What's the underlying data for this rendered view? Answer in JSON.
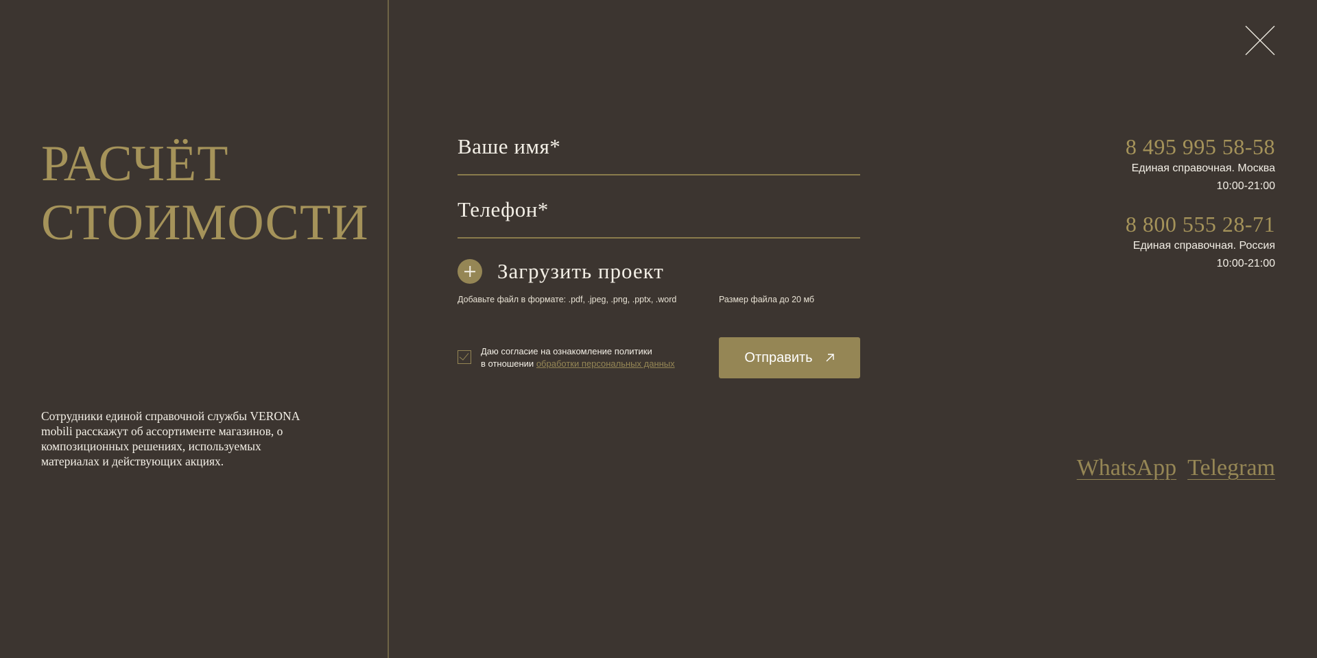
{
  "left": {
    "title_line1": "РАСЧЁТ",
    "title_line2": "СТОИМОСТИ",
    "description": "Сотрудники единой справочной службы VERONA mobili расскажут об ассортименте магазинов, о композиционных решениях, используемых материалах и действующих акциях."
  },
  "form": {
    "name_label": "Ваше имя*",
    "phone_label": "Телефон*",
    "upload_label": "Загрузить проект",
    "upload_formats_hint": "Добавьте файл в формате: .pdf, .jpeg, .png, .pptx, .word",
    "upload_size_hint": "Размер файла до 20 мб",
    "consent_checked": true,
    "consent_line1": "Даю согласие на ознакомление политики",
    "consent_line2_prefix": "в отношении ",
    "consent_link": "обработки персональных данных",
    "submit_label": "Отправить"
  },
  "contacts": [
    {
      "phone": "8 495 995 58-58",
      "caption": "Единая справочная. Москва",
      "hours": "10:00-21:00"
    },
    {
      "phone": "8 800 555 28-71",
      "caption": "Единая справочная. Россия",
      "hours": "10:00-21:00"
    }
  ],
  "messengers": {
    "whatsapp": "WhatsApp",
    "telegram": "Telegram"
  },
  "icons": {
    "close": "close-icon",
    "plus": "plus-icon",
    "checkmark": "checkmark-icon",
    "arrow": "arrow-up-right-icon"
  },
  "colors": {
    "background": "#3c3530",
    "accent": "#958655",
    "title": "#a5935a",
    "text": "#f3efe6"
  }
}
